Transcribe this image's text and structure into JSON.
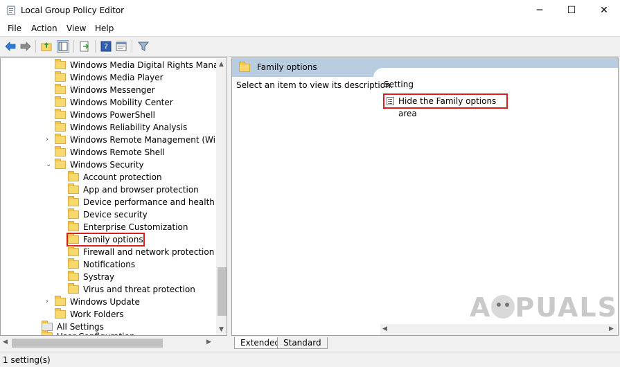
{
  "window": {
    "title": "Local Group Policy Editor",
    "minimize_glyph": "─",
    "maximize_glyph": "☐",
    "close_glyph": "✕"
  },
  "menu": [
    "File",
    "Action",
    "View",
    "Help"
  ],
  "toolbar": {
    "icons": [
      "back-arrow-icon",
      "forward-arrow-icon",
      "up-folder-icon",
      "show-hide-tree-icon",
      "export-list-icon",
      "help-icon",
      "properties-icon",
      "filter-icon"
    ]
  },
  "tree": {
    "items": [
      {
        "label": "Windows Media Digital Rights Manager",
        "expandable": false
      },
      {
        "label": "Windows Media Player",
        "expandable": false
      },
      {
        "label": "Windows Messenger",
        "expandable": false
      },
      {
        "label": "Windows Mobility Center",
        "expandable": false
      },
      {
        "label": "Windows PowerShell",
        "expandable": false
      },
      {
        "label": "Windows Reliability Analysis",
        "expandable": false
      },
      {
        "label": "Windows Remote Management (WinRM",
        "expandable": true
      },
      {
        "label": "Windows Remote Shell",
        "expandable": false
      },
      {
        "label": "Windows Security",
        "expanded": true
      },
      {
        "label": "Account protection"
      },
      {
        "label": "App and browser protection"
      },
      {
        "label": "Device performance and health"
      },
      {
        "label": "Device security"
      },
      {
        "label": "Enterprise Customization"
      },
      {
        "label": "Family options",
        "selected": true
      },
      {
        "label": "Firewall and network protection"
      },
      {
        "label": "Notifications"
      },
      {
        "label": "Systray"
      },
      {
        "label": "Virus and threat protection"
      },
      {
        "label": "Windows Update",
        "expandable": true
      },
      {
        "label": "Work Folders"
      },
      {
        "label": "All Settings"
      },
      {
        "label": "User Configuration",
        "partial": true
      }
    ]
  },
  "right": {
    "header_title": "Family options",
    "description": "Select an item to view its description.",
    "column_header": "Setting",
    "settings": [
      "Hide the Family options area"
    ]
  },
  "tabs": [
    "Extended",
    "Standard"
  ],
  "status": "1 setting(s)",
  "watermark": "APPUALS",
  "colors": {
    "highlight_border": "#d61f1f",
    "header_band": "#b8cde0",
    "folder": "#f9d86c"
  }
}
